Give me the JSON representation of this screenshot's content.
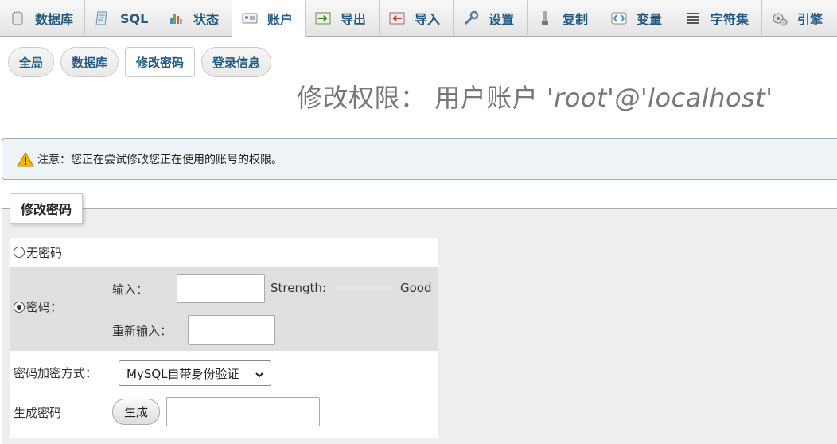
{
  "top_tabs": [
    {
      "label": "数据库",
      "icon": "database-icon",
      "active": false
    },
    {
      "label": "SQL",
      "icon": "sql-icon",
      "active": false
    },
    {
      "label": "状态",
      "icon": "status-icon",
      "active": false
    },
    {
      "label": "账户",
      "icon": "accounts-icon",
      "active": true
    },
    {
      "label": "导出",
      "icon": "export-icon",
      "active": false
    },
    {
      "label": "导入",
      "icon": "import-icon",
      "active": false
    },
    {
      "label": "设置",
      "icon": "settings-icon",
      "active": false
    },
    {
      "label": "复制",
      "icon": "replication-icon",
      "active": false
    },
    {
      "label": "变量",
      "icon": "variables-icon",
      "active": false
    },
    {
      "label": "字符集",
      "icon": "charset-icon",
      "active": false
    },
    {
      "label": "引擎",
      "icon": "engine-icon",
      "active": false
    }
  ],
  "sub_tabs": [
    {
      "label": "全局",
      "active": false
    },
    {
      "label": "数据库",
      "active": false
    },
    {
      "label": "修改密码",
      "active": true
    },
    {
      "label": "登录信息",
      "active": false
    }
  ],
  "title": {
    "prefix": "修改权限：",
    "middle": "用户账户",
    "account": "'root'@'localhost'"
  },
  "notice": {
    "text": "注意：您正在尝试修改您正在使用的账号的权限。",
    "icon": "warning-icon"
  },
  "form": {
    "legend": "修改密码",
    "no_password_label": "无密码",
    "password_label": "密码：",
    "no_password_selected": false,
    "password_selected": true,
    "enter_label": "输入：",
    "reenter_label": "重新输入：",
    "enter_value": "",
    "reenter_value": "",
    "strength_label": "Strength:",
    "strength_value": "Good",
    "hash_label": "密码加密方式：",
    "hash_selected": "MySQL自带身份验证",
    "generate_label": "生成密码",
    "generate_button": "生成",
    "generated_value": ""
  },
  "colors": {
    "tab_text": "#235a81",
    "notice_bg": "#eef3f7",
    "warning": "#f2b500"
  }
}
